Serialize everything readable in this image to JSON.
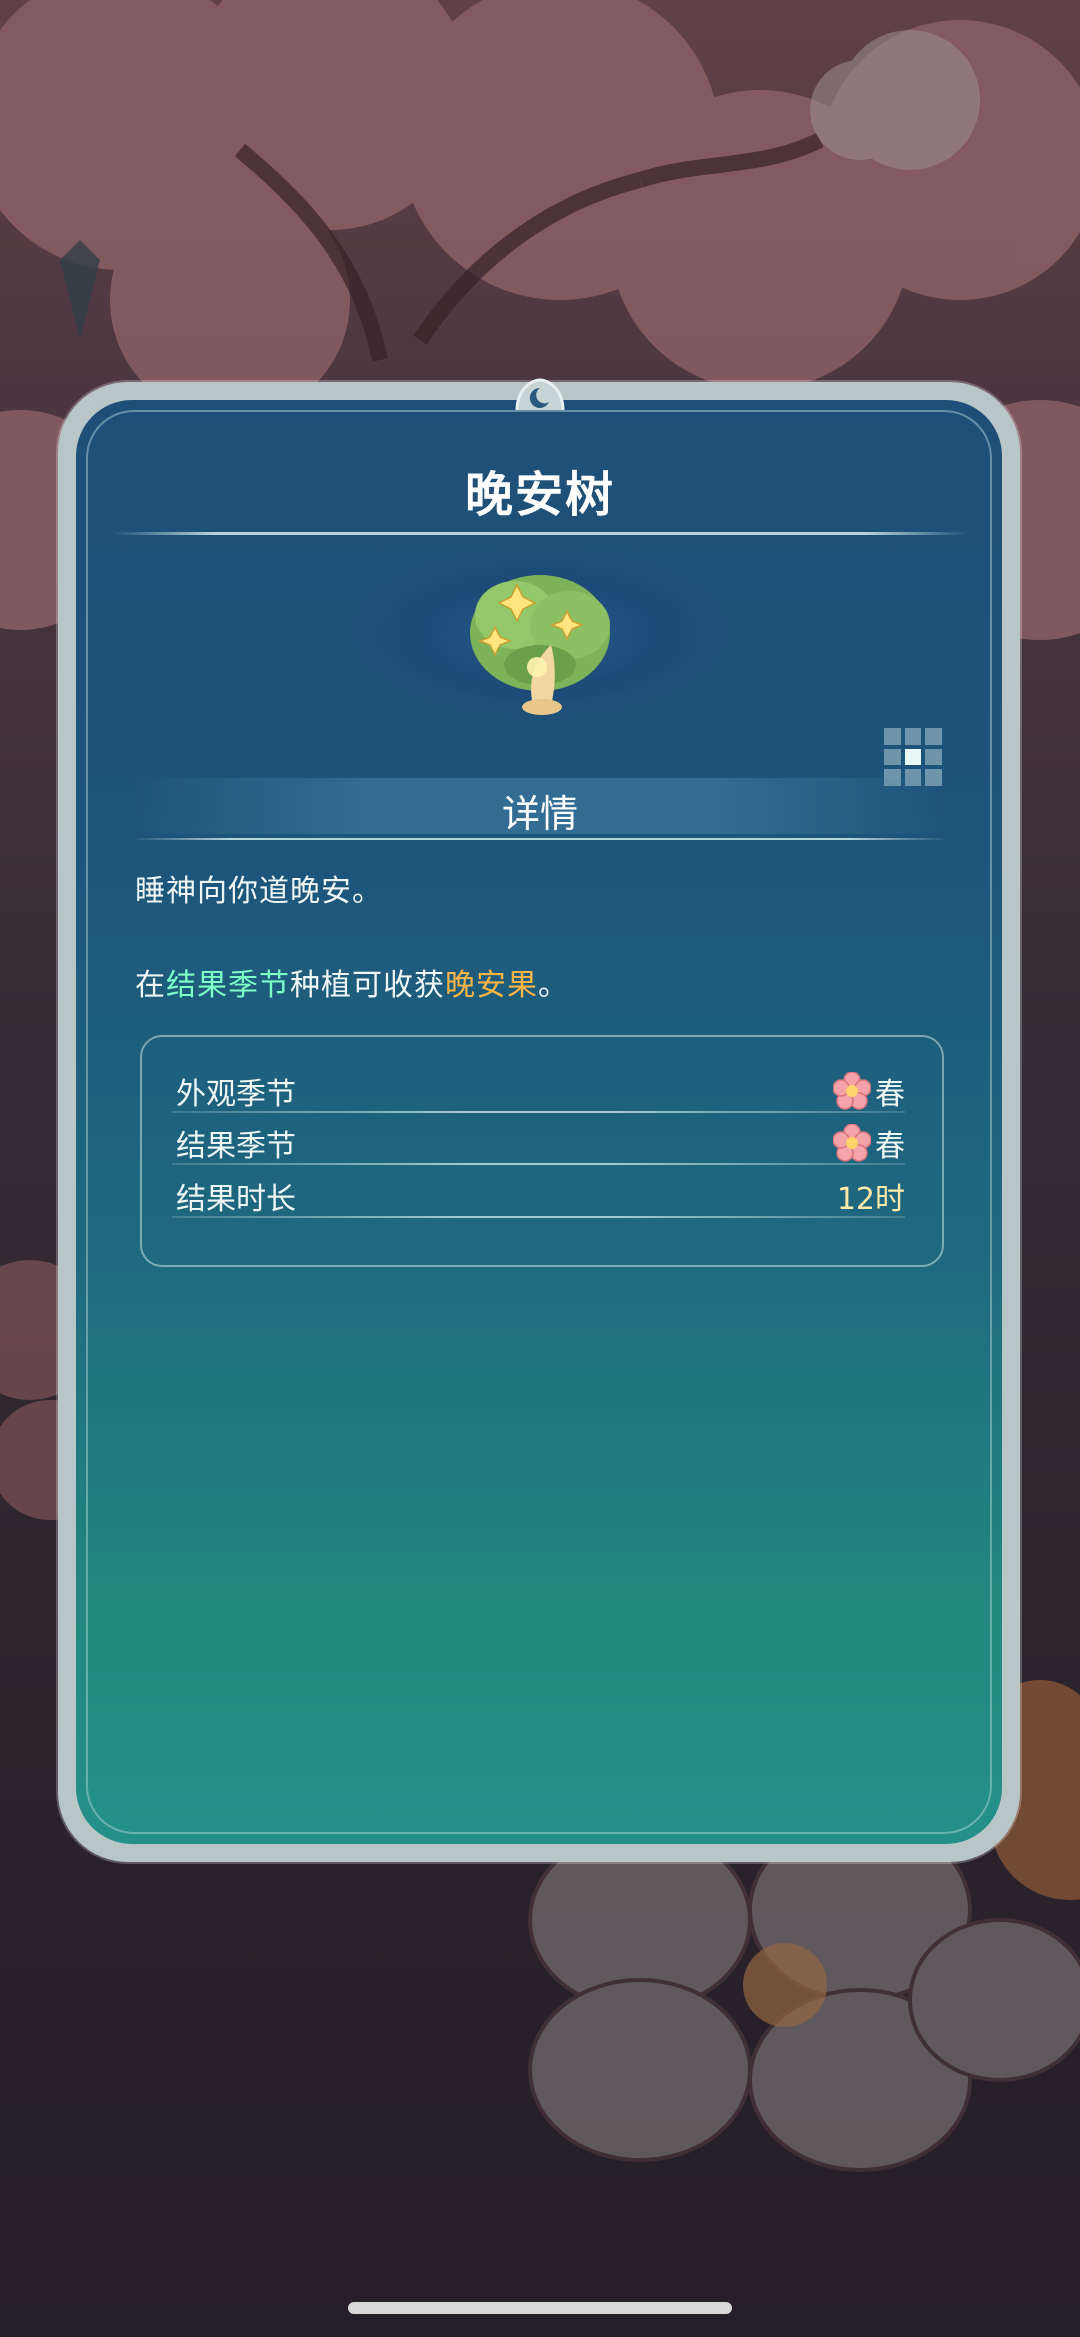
{
  "dialog": {
    "title": "晚安树",
    "section_title": "详情",
    "description_1": "睡神向你道晚安。",
    "description_2": {
      "prefix": "在",
      "highlight_1": "结果季节",
      "middle": "种植可收获",
      "highlight_2": "晚安果",
      "suffix": "。"
    },
    "stats": [
      {
        "label": "外观季节",
        "value": "春",
        "icon": "cherry-blossom-icon"
      },
      {
        "label": "结果季节",
        "value": "春",
        "icon": "cherry-blossom-icon"
      },
      {
        "label": "结果时长",
        "value": "12时"
      }
    ]
  },
  "icons": {
    "view_toggle": "grid-view-icon",
    "plant": "goodnight-tree-icon"
  },
  "colors": {
    "highlight_green": "#7dffc7",
    "highlight_orange": "#ffb545",
    "panel_top": "#1f4f78",
    "panel_bottom": "#25908a"
  }
}
